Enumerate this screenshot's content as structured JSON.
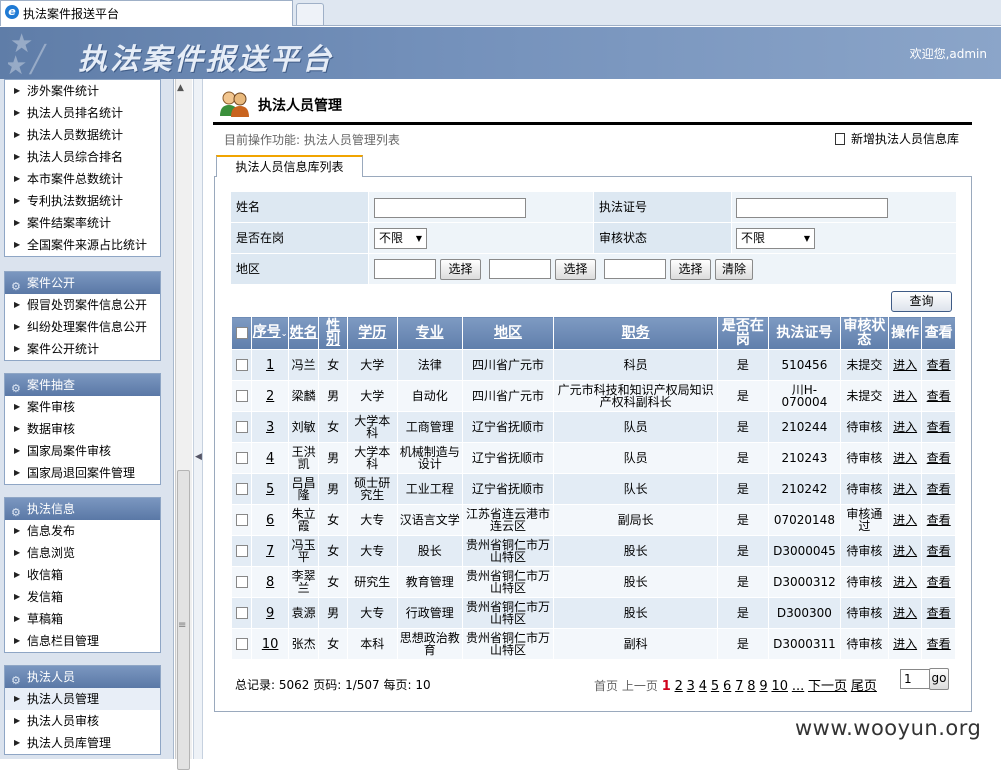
{
  "browser": {
    "tab_title": "执法案件报送平台"
  },
  "header": {
    "title": "执法案件报送平台",
    "welcome": "欢迎您,admin"
  },
  "sidebar": {
    "group_top": [
      "涉外案件统计",
      "执法人员排名统计",
      "执法人员数据统计",
      "执法人员综合排名",
      "本市案件总数统计",
      "专利执法数据统计",
      "案件结案率统计",
      "全国案件来源占比统计"
    ],
    "groups": [
      {
        "title": "案件公开",
        "items": [
          "假冒处罚案件信息公开",
          "纠纷处理案件信息公开",
          "案件公开统计"
        ]
      },
      {
        "title": "案件抽查",
        "items": [
          "案件审核",
          "数据审核",
          "国家局案件审核",
          "国家局退回案件管理"
        ]
      },
      {
        "title": "执法信息",
        "items": [
          "信息发布",
          "信息浏览",
          "收信箱",
          "发信箱",
          "草稿箱",
          "信息栏目管理"
        ]
      },
      {
        "title": "执法人员",
        "items": [
          "执法人员管理",
          "执法人员审核",
          "执法人员库管理"
        ]
      }
    ]
  },
  "main": {
    "page_title": "执法人员管理",
    "operation": "目前操作功能: 执法人员管理列表",
    "new_link": "新增执法人员信息库",
    "tab": "执法人员信息库列表"
  },
  "search": {
    "name_label": "姓名",
    "cert_label": "执法证号",
    "onduty_label": "是否在岗",
    "onduty_value": "不限",
    "status_label": "审核状态",
    "status_value": "不限",
    "region_label": "地区",
    "choose_label": "选择",
    "clear_label": "清除",
    "query_label": "查询"
  },
  "table": {
    "headers": [
      "序号",
      "姓名",
      "性别",
      "学历",
      "专业",
      "地区",
      "职务",
      "是否在岗",
      "执法证号",
      "审核状态",
      "操作",
      "查看"
    ],
    "enter_label": "进入",
    "view_label": "查看",
    "rows": [
      [
        "1",
        "冯兰",
        "女",
        "大学",
        "法律",
        "四川省广元市",
        "科员",
        "是",
        "510456",
        "未提交"
      ],
      [
        "2",
        "梁麟",
        "男",
        "大学",
        "自动化",
        "四川省广元市",
        "广元市科技和知识产权局知识产权科副科长",
        "是",
        "川H-070004",
        "未提交"
      ],
      [
        "3",
        "刘敏",
        "女",
        "大学本科",
        "工商管理",
        "辽宁省抚顺市",
        "队员",
        "是",
        "210244",
        "待审核"
      ],
      [
        "4",
        "王洪凯",
        "男",
        "大学本科",
        "机械制造与设计",
        "辽宁省抚顺市",
        "队员",
        "是",
        "210243",
        "待审核"
      ],
      [
        "5",
        "吕昌隆",
        "男",
        "硕士研究生",
        "工业工程",
        "辽宁省抚顺市",
        "队长",
        "是",
        "210242",
        "待审核"
      ],
      [
        "6",
        "朱立霞",
        "女",
        "大专",
        "汉语言文学",
        "江苏省连云港市连云区",
        "副局长",
        "是",
        "07020148",
        "审核通过"
      ],
      [
        "7",
        "冯玉平",
        "女",
        "大专",
        "股长",
        "贵州省铜仁市万山特区",
        "股长",
        "是",
        "D3000045",
        "待审核"
      ],
      [
        "8",
        "李翠兰",
        "女",
        "研究生",
        "教育管理",
        "贵州省铜仁市万山特区",
        "股长",
        "是",
        "D3000312",
        "待审核"
      ],
      [
        "9",
        "袁源",
        "男",
        "大专",
        "行政管理",
        "贵州省铜仁市万山特区",
        "股长",
        "是",
        "D300300",
        "待审核"
      ],
      [
        "10",
        "张杰",
        "女",
        "本科",
        "思想政治教育",
        "贵州省铜仁市万山特区",
        "副科",
        "是",
        "D3000311",
        "待审核"
      ]
    ]
  },
  "footer": {
    "summary": "总记录: 5062 页码: 1/507 每页: 10",
    "first": "首页",
    "prev": "上一页",
    "current": "1",
    "pages": [
      "2",
      "3",
      "4",
      "5",
      "6",
      "7",
      "8",
      "9",
      "10"
    ],
    "ellipsis": "...",
    "next": "下一页",
    "last": "尾页",
    "page_input": "1",
    "go_label": "go"
  },
  "watermark": "www.wooyun.org",
  "colors": {
    "header_bg": "#6f8cb6",
    "table_header": "#6f8cb6",
    "row_odd": "#e3ecf5",
    "current_page": "#d0021b",
    "tab_accent": "#f1a400"
  }
}
